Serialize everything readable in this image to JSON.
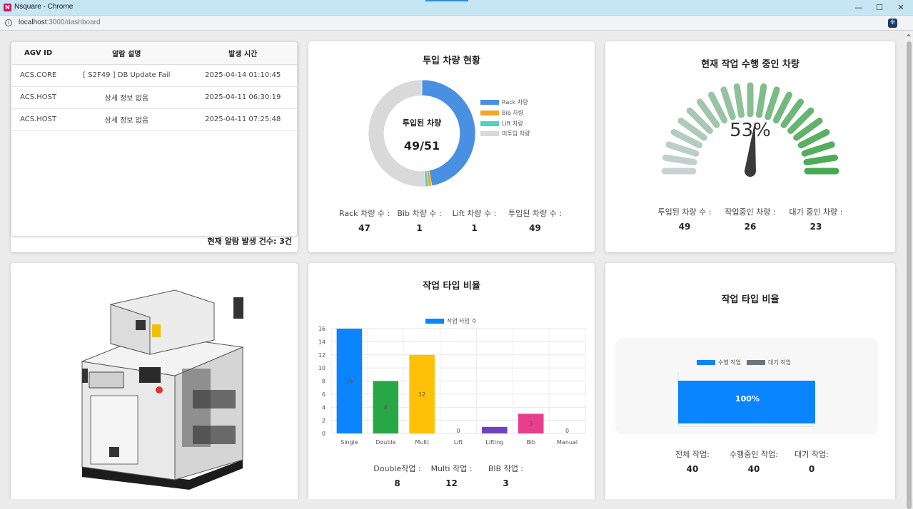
{
  "window": {
    "title": "Nsquare - Chrome",
    "url_host": "localhost",
    "url_path": ":3000/dashboard",
    "logo_letter": "N"
  },
  "colors": {
    "blue": "#4a90e2",
    "orange": "#f5a623",
    "teal": "#4ad5c0",
    "gray": "#d9d9d9",
    "bar_blue": "#0a84ff",
    "bar_green": "#28a745",
    "bar_yellow": "#ffc107",
    "bar_purple": "#6f42c1",
    "bar_pink": "#e83e8c",
    "idle_gray": "#6c757d"
  },
  "alarm": {
    "headers": [
      "AGV ID",
      "알람 설명",
      "발생 시간"
    ],
    "rows": [
      [
        "ACS.CORE",
        "[ S2F49 ] DB Update Fail",
        "2025-04-14 01:10:45"
      ],
      [
        "ACS.HOST",
        "상세 정보 없음",
        "2025-04-11 06:30:19"
      ],
      [
        "ACS.HOST",
        "상세 정보 없음",
        "2025-04-11 07:25:48"
      ]
    ],
    "count_text": "현재 알람 발생 건수: 3건"
  },
  "deployed": {
    "title": "투입 차량 현황",
    "center_label": "투입된 차량",
    "center_value": "49/51",
    "legend": [
      "Rack 차량",
      "Bib 차량",
      "Lift 차량",
      "미투입 차량"
    ],
    "stats": [
      {
        "label": "Rack 차량 수 :",
        "value": "47"
      },
      {
        "label": "Bib 차량 수 :",
        "value": "1"
      },
      {
        "label": "Lift 차량 수 :",
        "value": "1"
      },
      {
        "label": "투입된 차량 수 :",
        "value": "49"
      }
    ]
  },
  "working": {
    "title": "현재 작업 수행 중인 차량",
    "percent_text": "53%",
    "percent": 53,
    "stats": [
      {
        "label": "투입된 차량 수 :",
        "value": "49"
      },
      {
        "label": "작업중인 차량 :",
        "value": "26"
      },
      {
        "label": "대기 중인 차량 :",
        "value": "23"
      }
    ]
  },
  "job_types": {
    "title": "작업 타입 비율",
    "stats": [
      {
        "label": "Double작업 :",
        "value": "8"
      },
      {
        "label": "Multi 작업 :",
        "value": "12"
      },
      {
        "label": "BIB 작업 :",
        "value": "3"
      }
    ]
  },
  "job_ratio": {
    "title": "작업 타입 비율",
    "stats": [
      {
        "label": "전체 작업:",
        "value": "40"
      },
      {
        "label": "수행중인 작업:",
        "value": "40"
      },
      {
        "label": "대기 작업:",
        "value": "0"
      }
    ]
  },
  "chart_data": [
    {
      "type": "pie",
      "categories": [
        "Rack 차량",
        "Bib 차량",
        "Lift 차량",
        "미투입 차량"
      ],
      "values": [
        47,
        1,
        1,
        51
      ]
    },
    {
      "type": "bar",
      "categories": [
        "Single",
        "Double",
        "Multi",
        "Lift",
        "Lifting",
        "Bib",
        "Manual"
      ],
      "series": [
        {
          "name": "작업 타입 수",
          "values": [
            16,
            8,
            12,
            0,
            1,
            3,
            0
          ]
        }
      ],
      "data_labels": [
        "16",
        "8",
        "12",
        "0",
        "",
        "3",
        "0"
      ],
      "yticks": [
        "0",
        "2",
        "4",
        "6",
        "8",
        "10",
        "12",
        "14",
        "16"
      ],
      "ylim": [
        0,
        16
      ],
      "grid": true,
      "legend": "top"
    },
    {
      "type": "bar",
      "orientation": "horizontal-stacked",
      "series": [
        {
          "name": "수행 작업",
          "values": [
            100
          ]
        },
        {
          "name": "대기 작업",
          "values": [
            0
          ]
        }
      ],
      "data_label": "100%",
      "xlim": [
        0,
        100
      ],
      "legend": "top"
    }
  ]
}
